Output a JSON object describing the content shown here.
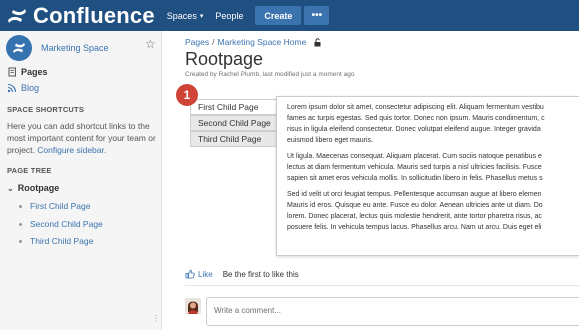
{
  "topnav": {
    "logo_text": "Confluence",
    "spaces_label": "Spaces",
    "people_label": "People",
    "create_label": "Create",
    "more_label": "•••",
    "color": "#205081"
  },
  "sidebar": {
    "space_name": "Marketing Space",
    "pages_label": "Pages",
    "blog_label": "Blog",
    "shortcuts_heading": "SPACE SHORTCUTS",
    "shortcuts_text": "Here you can add shortcut links to the most important content for your team or project.",
    "configure_link": "Configure sidebar.",
    "tree_heading": "PAGE TREE",
    "tree_root": "Rootpage",
    "tree_children": [
      "First Child Page",
      "Second Child Page",
      "Third Child Page"
    ]
  },
  "page": {
    "breadcrumb": [
      "Pages",
      "Marketing Space Home"
    ],
    "breadcrumb_sep": "/",
    "title": "Rootpage",
    "meta": "Created by Rachel Plumb, last modified just a moment ago"
  },
  "tabs": {
    "badge": "1",
    "items": [
      "First Child Page",
      "Second Child Page",
      "Third Child Page"
    ],
    "active_index": 0
  },
  "content": {
    "paragraphs": [
      [
        "Lorem ipsum dolor sit amet, consectetur adipiscing elit. Aliquam fermentum vestibu",
        "fames ac turpis egestas. Sed quis tortor. Donec non ipsum. Mauris condimentum, c",
        "risus in ligula eleifend consectetur. Donec volutpat eleifend augue. Integer gravida",
        "euismod libero eget mauris."
      ],
      [
        "Ut ligula. Maecenas consequat. Aliquam placerat. Cum sociis natoque penatibus e",
        "lectus at diam fermentum vehicula. Mauris sed turpis a nisl ultricies facilisis. Fusce",
        "sapien sit amet eros vehicula mollis. In sollicitudin libero in felis. Phasellus metus s"
      ],
      [
        "Sed id velit ut orci feugiat tempus. Pellentesque accumsan augue at libero elemen",
        "Mauris id eros. Quisque eu ante. Fusce eu dolor. Aenean ultricies ante ut diam. Do",
        "lorem. Donec placerat, lectus quis molestie hendrerit, ante tortor pharetra risus, ac",
        "posuere felis. In vehicula tempus lacus. Phasellus arcu. Nam ut arcu. Duis eget eli"
      ]
    ]
  },
  "footer": {
    "like_label": "Like",
    "like_text": "Be the first to like this",
    "comment_placeholder": "Write a comment..."
  }
}
